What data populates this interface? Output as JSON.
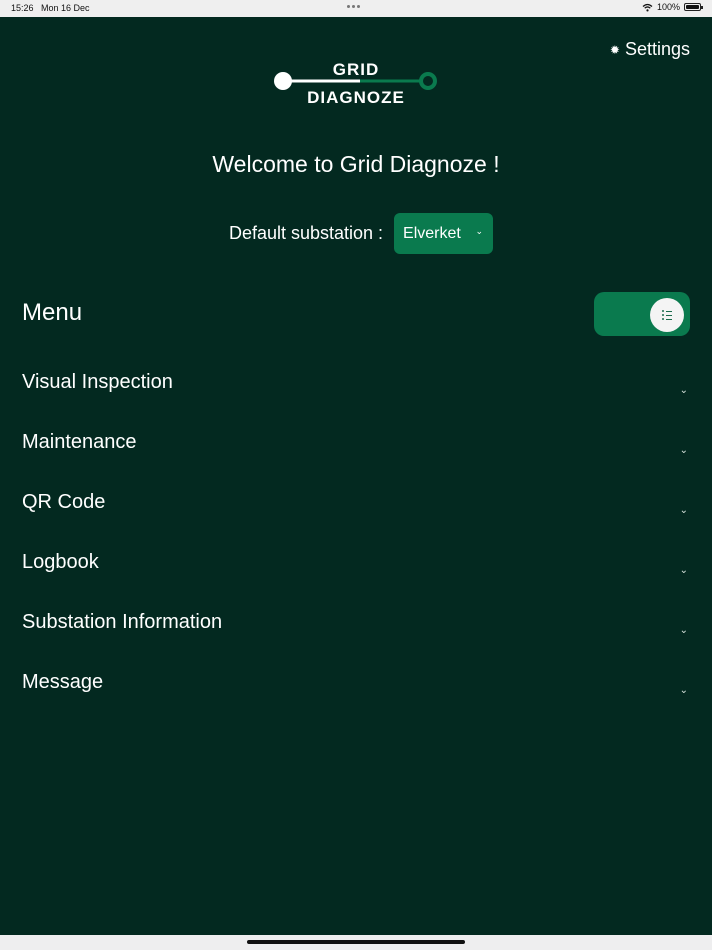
{
  "status_bar": {
    "time": "15:26",
    "date": "Mon 16 Dec",
    "battery": "100%"
  },
  "header": {
    "settings_label": "Settings",
    "logo_line1": "GRID",
    "logo_line2": "DIAGNOZE"
  },
  "welcome_text": "Welcome to Grid Diagnoze !",
  "default_substation": {
    "label": "Default substation :",
    "value": "Elverket"
  },
  "menu": {
    "title": "Menu",
    "items": [
      {
        "label": "Visual Inspection"
      },
      {
        "label": "Maintenance"
      },
      {
        "label": "QR Code"
      },
      {
        "label": "Logbook"
      },
      {
        "label": "Substation Information"
      },
      {
        "label": "Message"
      }
    ]
  },
  "colors": {
    "background": "#032920",
    "accent": "#0a7a4e",
    "text": "#ffffff"
  },
  "icons": {
    "settings": "gear-icon",
    "dropdown": "chevron-down-icon",
    "toggle": "list-icon",
    "wifi": "wifi-icon",
    "battery": "battery-icon"
  }
}
